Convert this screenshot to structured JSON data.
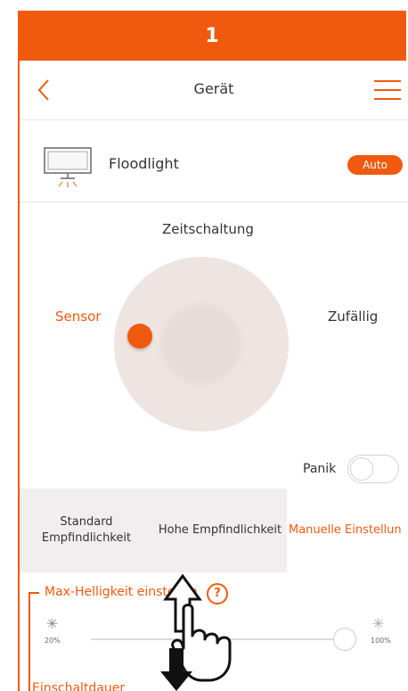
{
  "step_number": "1",
  "accent_color": "#f05a0f",
  "navbar": {
    "title": "Gerät",
    "back_icon": "chevron-left-icon",
    "menu_icon": "hamburger-icon"
  },
  "device": {
    "name": "Floodlight",
    "badge": "Auto",
    "icon": "floodlight-icon"
  },
  "modes": {
    "top": "Zeitschaltung",
    "left": "Sensor",
    "right": "Zufällig",
    "active": "Sensor"
  },
  "panic": {
    "label": "Panik",
    "enabled": false
  },
  "tabs": [
    {
      "label": "Standard Empfindlichkeit",
      "active": false
    },
    {
      "label": "Hohe Empfindlichkeit",
      "active": false
    },
    {
      "label": "Manuelle Einstellun",
      "active": true
    }
  ],
  "brightness": {
    "title": "Max-Helligkeit einstellen",
    "help": "?",
    "min_label": "20%",
    "max_label": "100%",
    "value_percent": 100
  },
  "duration": {
    "title": "Einschaltdauer"
  }
}
